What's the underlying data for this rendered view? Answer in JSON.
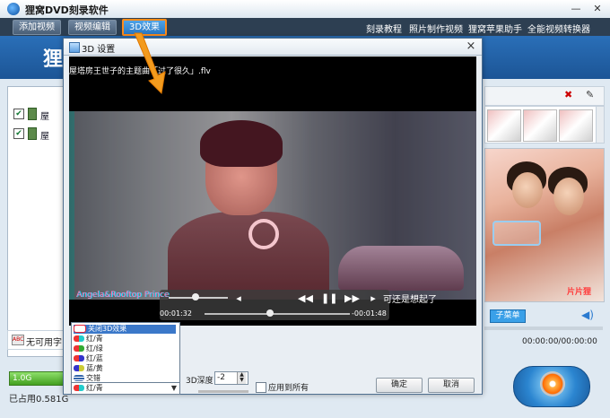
{
  "app": {
    "title": "狸窝DVD刻录软件",
    "minimize": "—",
    "close": "✕",
    "banner_title": "狸"
  },
  "menu": {
    "add_video": "添加视频",
    "edit_video": "视频编辑",
    "effect_3d": "3D效果",
    "links": [
      "刻录教程",
      "照片制作视频",
      "狸窝苹果助手",
      "全能视频转换器"
    ]
  },
  "left_panel": {
    "files": [
      {
        "label": "屋",
        "checked": true
      },
      {
        "label": "屋",
        "checked": true
      }
    ],
    "subtitle_icon": "ABC",
    "subtitle_text": "无可用字",
    "disc_capacity": "1.0G",
    "used_label": "已占用0.581G"
  },
  "right_panel": {
    "sub_menu_button": "子菜单",
    "time": "00:00:00/00:00:00",
    "preview_badge": "片片狸",
    "burn_icon": "disc-flame-icon"
  },
  "dialog": {
    "title": "3D 设置",
    "close": "×",
    "filename": "屋塔房王世子的主题曲「过了很久」.flv",
    "player": {
      "time_current": "00:01:32",
      "time_remaining": "-00:01:48",
      "volume_fraction": 0.45,
      "seek_fraction": 0.45,
      "watermark": "Angela&Rooftop Prince",
      "subtitle_right": "可还是想起了",
      "controls": [
        "◂",
        "◀◀",
        "❚❚",
        "▶▶",
        "▸"
      ]
    },
    "modes": [
      {
        "label": "关闭3D效果",
        "selected": true,
        "color": "#e23"
      },
      {
        "label": "红/青",
        "selected": false,
        "color": "#e33"
      },
      {
        "label": "红/绿",
        "selected": false,
        "color": "#3a3"
      },
      {
        "label": "红/蓝",
        "selected": false,
        "color": "#33c"
      },
      {
        "label": "蓝/黄",
        "selected": false,
        "color": "#cc3"
      },
      {
        "label": "交错",
        "selected": false,
        "color": "#36a"
      }
    ],
    "current_mode": "红/青",
    "depth_label": "3D深度",
    "depth_value": "-2",
    "apply_all_label": "应用到所有",
    "ok": "确定",
    "cancel": "取消"
  }
}
